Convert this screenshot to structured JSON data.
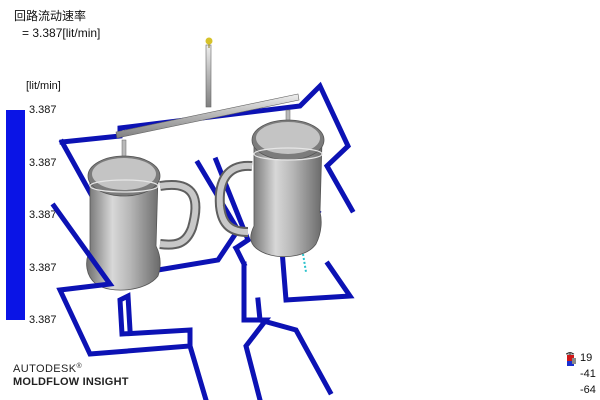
{
  "result": {
    "title": "回路流动速率",
    "value": "= 3.387[lit/min]"
  },
  "legend": {
    "unit": "[lit/min]",
    "ticks": [
      "3.387",
      "3.387",
      "3.387",
      "3.387",
      "3.387"
    ],
    "bar_color": "#0a14e6"
  },
  "model": {
    "cooling_line_color": "#0c12b4",
    "part_color": "#a9a9a9",
    "highlight_color": "#e8e8e8",
    "injection_marker_color": "#d6c22a",
    "probe_color": "#2bc2cc"
  },
  "brand": {
    "line1": "AUTODESK",
    "line1_mark": "®",
    "line2": "MOLDFLOW",
    "line2_rest": " INSIGHT"
  },
  "triad": {
    "values": [
      "19",
      "-41",
      "-64"
    ]
  }
}
